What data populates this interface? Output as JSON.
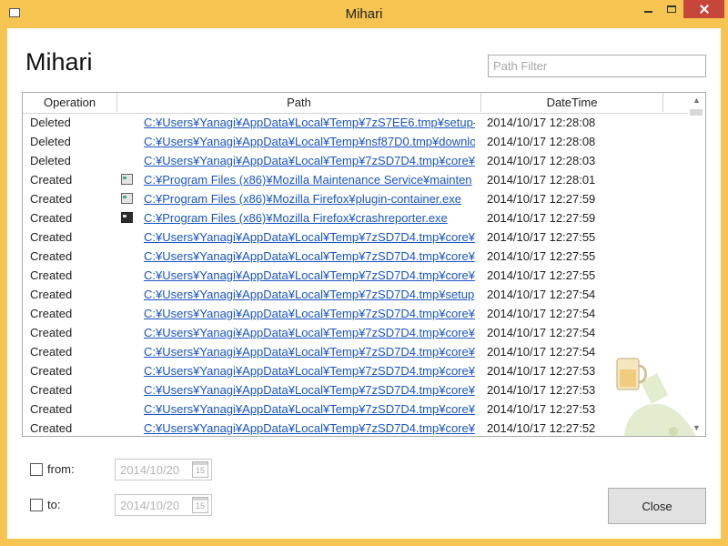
{
  "window": {
    "title": "Mihari"
  },
  "app": {
    "heading": "Mihari"
  },
  "filter": {
    "placeholder": "Path Filter",
    "value": ""
  },
  "grid": {
    "headers": {
      "operation": "Operation",
      "path": "Path",
      "datetime": "DateTime"
    },
    "rows": [
      {
        "operation": "Deleted",
        "path": "C:¥Users¥Yanagi¥AppData¥Local¥Temp¥7zS7EE6.tmp¥setup-",
        "datetime": "2014/10/17 12:28:08",
        "icon": ""
      },
      {
        "operation": "Deleted",
        "path": "C:¥Users¥Yanagi¥AppData¥Local¥Temp¥nsf87D0.tmp¥downlo",
        "datetime": "2014/10/17 12:28:08",
        "icon": ""
      },
      {
        "operation": "Deleted",
        "path": "C:¥Users¥Yanagi¥AppData¥Local¥Temp¥7zSD7D4.tmp¥core¥",
        "datetime": "2014/10/17 12:28:03",
        "icon": ""
      },
      {
        "operation": "Created",
        "path": "C:¥Program Files (x86)¥Mozilla Maintenance Service¥mainten",
        "datetime": "2014/10/17 12:28:01",
        "icon": "exe-icon"
      },
      {
        "operation": "Created",
        "path": "C:¥Program Files (x86)¥Mozilla Firefox¥plugin-container.exe",
        "datetime": "2014/10/17 12:27:59",
        "icon": "exe-icon"
      },
      {
        "operation": "Created",
        "path": "C:¥Program Files (x86)¥Mozilla Firefox¥crashreporter.exe",
        "datetime": "2014/10/17 12:27:59",
        "icon": "crashreporter-icon"
      },
      {
        "operation": "Created",
        "path": "C:¥Users¥Yanagi¥AppData¥Local¥Temp¥7zSD7D4.tmp¥core¥",
        "datetime": "2014/10/17 12:27:55",
        "icon": ""
      },
      {
        "operation": "Created",
        "path": "C:¥Users¥Yanagi¥AppData¥Local¥Temp¥7zSD7D4.tmp¥core¥",
        "datetime": "2014/10/17 12:27:55",
        "icon": ""
      },
      {
        "operation": "Created",
        "path": "C:¥Users¥Yanagi¥AppData¥Local¥Temp¥7zSD7D4.tmp¥core¥",
        "datetime": "2014/10/17 12:27:55",
        "icon": ""
      },
      {
        "operation": "Created",
        "path": "C:¥Users¥Yanagi¥AppData¥Local¥Temp¥7zSD7D4.tmp¥setup",
        "datetime": "2014/10/17 12:27:54",
        "icon": ""
      },
      {
        "operation": "Created",
        "path": "C:¥Users¥Yanagi¥AppData¥Local¥Temp¥7zSD7D4.tmp¥core¥",
        "datetime": "2014/10/17 12:27:54",
        "icon": ""
      },
      {
        "operation": "Created",
        "path": "C:¥Users¥Yanagi¥AppData¥Local¥Temp¥7zSD7D4.tmp¥core¥",
        "datetime": "2014/10/17 12:27:54",
        "icon": ""
      },
      {
        "operation": "Created",
        "path": "C:¥Users¥Yanagi¥AppData¥Local¥Temp¥7zSD7D4.tmp¥core¥",
        "datetime": "2014/10/17 12:27:54",
        "icon": ""
      },
      {
        "operation": "Created",
        "path": "C:¥Users¥Yanagi¥AppData¥Local¥Temp¥7zSD7D4.tmp¥core¥",
        "datetime": "2014/10/17 12:27:53",
        "icon": ""
      },
      {
        "operation": "Created",
        "path": "C:¥Users¥Yanagi¥AppData¥Local¥Temp¥7zSD7D4.tmp¥core¥",
        "datetime": "2014/10/17 12:27:53",
        "icon": ""
      },
      {
        "operation": "Created",
        "path": "C:¥Users¥Yanagi¥AppData¥Local¥Temp¥7zSD7D4.tmp¥core¥",
        "datetime": "2014/10/17 12:27:53",
        "icon": ""
      },
      {
        "operation": "Created",
        "path": "C:¥Users¥Yanagi¥AppData¥Local¥Temp¥7zSD7D4.tmp¥core¥",
        "datetime": "2014/10/17 12:27:52",
        "icon": ""
      }
    ]
  },
  "date_filters": {
    "from": {
      "label": "from:",
      "value": "2014/10/20",
      "checked": false,
      "calendar_day": "15"
    },
    "to": {
      "label": "to:",
      "value": "2014/10/20",
      "checked": false,
      "calendar_day": "15"
    }
  },
  "buttons": {
    "close": "Close"
  },
  "colors": {
    "window_frame": "#f6c451",
    "link": "#1a55c0",
    "close_window": "#c7463a"
  }
}
